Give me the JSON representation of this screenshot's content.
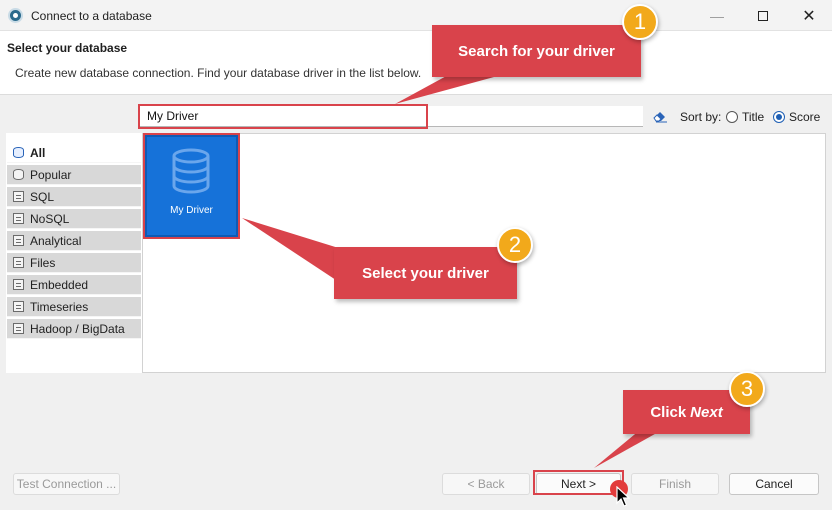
{
  "window": {
    "title": "Connect to a database",
    "controls": {
      "minimize": "—",
      "close": "✕"
    }
  },
  "header": {
    "title": "Select your database",
    "description": "Create new database connection. Find your database driver in the list below."
  },
  "search": {
    "value": "My Driver"
  },
  "sort": {
    "label": "Sort by:",
    "options": [
      {
        "label": "Title",
        "selected": false
      },
      {
        "label": "Score",
        "selected": true
      }
    ]
  },
  "categories": [
    {
      "label": "All",
      "icon": "database-icon",
      "active": true
    },
    {
      "label": "Popular",
      "icon": "database-icon",
      "active": false
    },
    {
      "label": "SQL",
      "icon": "document-icon",
      "active": false
    },
    {
      "label": "NoSQL",
      "icon": "document-icon",
      "active": false
    },
    {
      "label": "Analytical",
      "icon": "document-icon",
      "active": false
    },
    {
      "label": "Files",
      "icon": "document-icon",
      "active": false
    },
    {
      "label": "Embedded",
      "icon": "document-icon",
      "active": false
    },
    {
      "label": "Timeseries",
      "icon": "document-icon",
      "active": false
    },
    {
      "label": "Hadoop / BigData",
      "icon": "document-icon",
      "active": false
    }
  ],
  "drivers": [
    {
      "label": "My Driver",
      "icon": "database-icon",
      "selected": true
    }
  ],
  "annotations": [
    {
      "number": "1",
      "text": "Search for your driver"
    },
    {
      "number": "2",
      "text": "Select your driver"
    },
    {
      "number": "3",
      "text": "Click",
      "emphasis": "Next"
    }
  ],
  "footer": {
    "test_connection": "Test Connection ...",
    "back": "< Back",
    "next": "Next >",
    "finish": "Finish",
    "cancel": "Cancel"
  },
  "colors": {
    "accent": "#1672d9",
    "annotation": "#d9434b",
    "badge": "#f2a91b",
    "category_bg": "#d8d8d8"
  }
}
